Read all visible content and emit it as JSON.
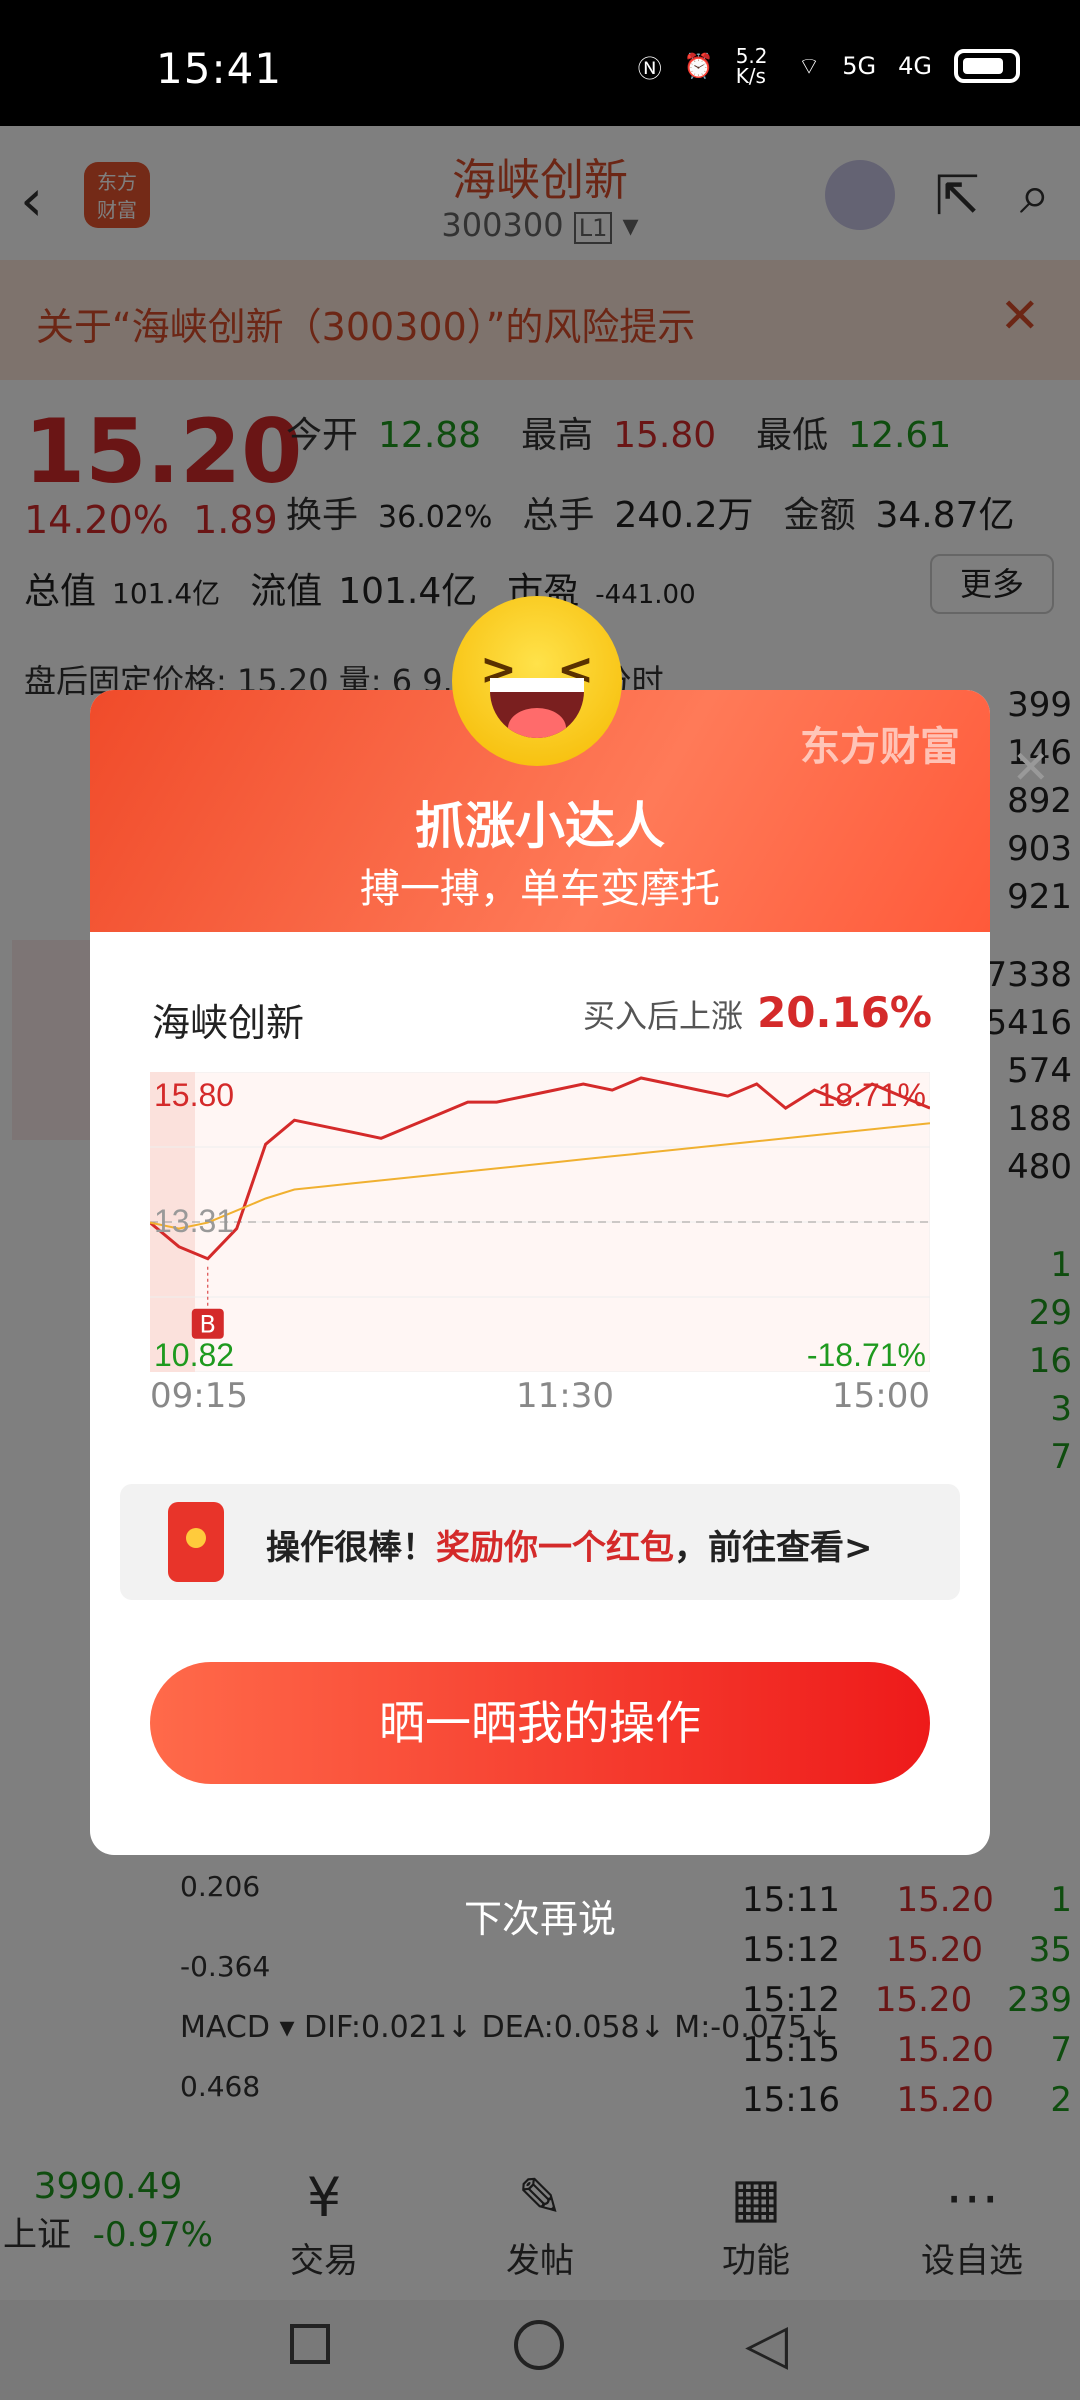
{
  "status_bar": {
    "time": "15:41",
    "speed": "5.2 K/s",
    "net1": "5G",
    "net2": "4G"
  },
  "header": {
    "logo": "东方 财富",
    "name": "海峡创新",
    "code": "300300",
    "level": "L1"
  },
  "risk": {
    "text": "关于“海峡创新（300300）”的风险提示"
  },
  "quote": {
    "price": "15.20",
    "pct": "14.20%",
    "chg": "1.89",
    "open_lbl": "今开",
    "open": "12.88",
    "high_lbl": "最高",
    "high": "15.80",
    "low_lbl": "最低",
    "low": "12.61",
    "turn_lbl": "换手",
    "turn": "36.02%",
    "vol_lbl": "总手",
    "vol": "240.2万",
    "amt_lbl": "金额",
    "amt": "34.87亿",
    "mcap_lbl": "总值",
    "mcap": "101.4亿",
    "float_lbl": "流值",
    "float": "101.4亿",
    "pe_lbl": "市盈",
    "pe": "-441.00",
    "more": "更多",
    "after_text": "盘后固定价格: 15.20   量: 6   9.10万   盘后分时"
  },
  "modal": {
    "brand": "东方财富",
    "title": "抓涨小达人",
    "subtitle": "搏一搏，单车变摩托",
    "stock": "海峡创新",
    "gain_label": "买入后上涨",
    "gain_value": "20.16%",
    "reward_pre": "操作很棒！",
    "reward_hl": "奖励你一个红包",
    "reward_post": "，前往查看>",
    "share_button": "晒一晒我的操作",
    "later": "下次再说"
  },
  "chart_data": {
    "type": "line",
    "y_top_label": "15.80",
    "y_mid_label": "13.31",
    "y_bottom_label": "10.82",
    "pct_top": "18.71%",
    "pct_bottom": "-18.71%",
    "x_labels": [
      "09:15",
      "11:30",
      "15:00"
    ],
    "buy_marker": "B",
    "ylim": [
      10.82,
      15.8
    ],
    "series": [
      {
        "values": [
          13.3,
          12.9,
          12.7,
          13.2,
          14.6,
          15.0,
          14.9,
          14.8,
          14.7,
          14.9,
          15.1,
          15.3,
          15.3,
          15.4,
          15.5,
          15.6,
          15.5,
          15.7,
          15.6,
          15.5,
          15.4,
          15.6,
          15.2,
          15.5,
          15.3,
          15.6,
          15.4,
          15.2
        ]
      },
      {
        "values": [
          13.3,
          13.2,
          13.3,
          13.5,
          13.7,
          13.85,
          13.9,
          13.95,
          14.0,
          14.05,
          14.1,
          14.15,
          14.2,
          14.25,
          14.3,
          14.35,
          14.4,
          14.45,
          14.5,
          14.55,
          14.6,
          14.65,
          14.7,
          14.75,
          14.8,
          14.85,
          14.9,
          14.95
        ]
      }
    ]
  },
  "bg": {
    "right_values": [
      "399",
      "146",
      "892",
      "903",
      "921",
      "7338",
      "5416",
      "574",
      "188",
      "480",
      "1",
      "29",
      "16",
      "3",
      "7"
    ],
    "ticks": [
      {
        "t": "15:11",
        "p": "15.20",
        "v": "1"
      },
      {
        "t": "15:12",
        "p": "15.20",
        "v": "35"
      },
      {
        "t": "15:12",
        "p": "15.20",
        "v": "239"
      },
      {
        "t": "15:15",
        "p": "15.20",
        "v": "7"
      },
      {
        "t": "15:16",
        "p": "15.20",
        "v": "2"
      }
    ],
    "macd": "MACD ▾  DIF:0.021↓  DEA:0.058↓  M:-0.075↓",
    "val1": "0.206",
    "val2": "-0.364",
    "val3": "0.468"
  },
  "bottom_nav": {
    "index_value": "3990.49",
    "index_name": "上证",
    "index_pct": "-0.97%",
    "items": [
      "交易",
      "发帖",
      "功能",
      "设自选"
    ]
  }
}
